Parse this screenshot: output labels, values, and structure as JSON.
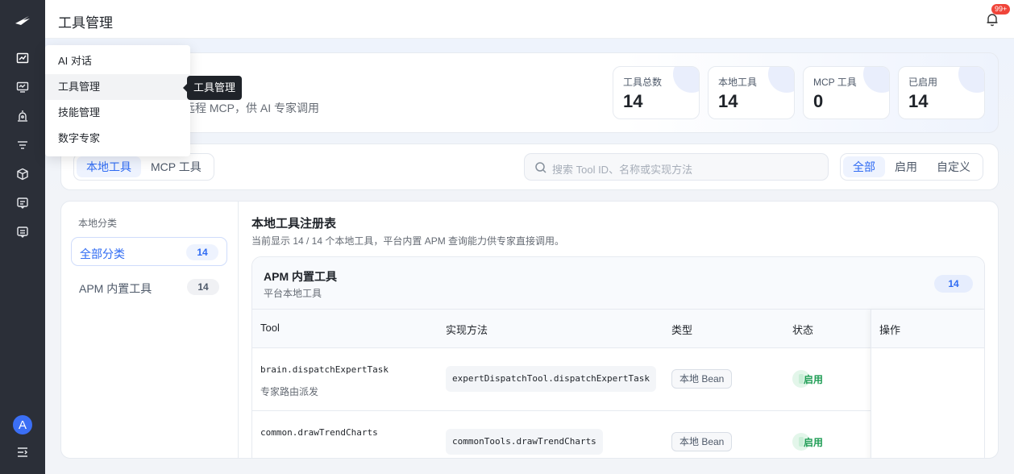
{
  "app": {
    "title": "工具管理",
    "notification_count": "99+",
    "avatar_letter": "A"
  },
  "sidebar": {
    "icons": [
      "logo-icon",
      "chat-analytics-icon",
      "monitor-icon",
      "alarm-icon",
      "filter-icon",
      "cube-icon",
      "message-icon",
      "document-icon",
      "collapse-icon"
    ]
  },
  "menu": {
    "items": [
      {
        "label": "AI 对话"
      },
      {
        "label": "工具管理"
      },
      {
        "label": "技能管理"
      },
      {
        "label": "数字专家"
      }
    ],
    "tooltip": "工具管理"
  },
  "hero": {
    "subtitle": "能力与远程 MCP，供 AI 专家调用",
    "stats": [
      {
        "label": "工具总数",
        "value": "14"
      },
      {
        "label": "本地工具",
        "value": "14"
      },
      {
        "label": "MCP 工具",
        "value": "0"
      },
      {
        "label": "已启用",
        "value": "14"
      }
    ]
  },
  "toolbar": {
    "source_tabs": [
      {
        "label": "本地工具"
      },
      {
        "label": "MCP 工具"
      }
    ],
    "search_placeholder": "搜索 Tool ID、名称或实现方法",
    "filters": [
      {
        "label": "全部"
      },
      {
        "label": "启用"
      },
      {
        "label": "自定义"
      }
    ]
  },
  "categories": {
    "title": "本地分类",
    "items": [
      {
        "label": "全部分类",
        "count": "14"
      },
      {
        "label": "APM 内置工具",
        "count": "14"
      }
    ]
  },
  "registry": {
    "title": "本地工具注册表",
    "subtitle": "当前显示 14 / 14 个本地工具，平台内置 APM 查询能力供专家直接调用。",
    "group": {
      "title": "APM 内置工具",
      "subtitle": "平台本地工具",
      "count": "14"
    },
    "columns": [
      "Tool",
      "实现方法",
      "类型",
      "状态",
      "操作"
    ],
    "rows": [
      {
        "tool_id": "brain.dispatchExpertTask",
        "desc": "专家路由派发",
        "method": "expertDispatchTool.dispatchExpertTask",
        "type": "本地 Bean",
        "status": "启用"
      },
      {
        "tool_id": "common.drawTrendCharts",
        "desc": "",
        "method": "commonTools.drawTrendCharts",
        "type": "本地 Bean",
        "status": "启用"
      }
    ]
  },
  "colors": {
    "accent": "#2f6bf3",
    "sidebar": "#2b2f38",
    "success": "#1f9d55",
    "badge": "#f0453a"
  }
}
